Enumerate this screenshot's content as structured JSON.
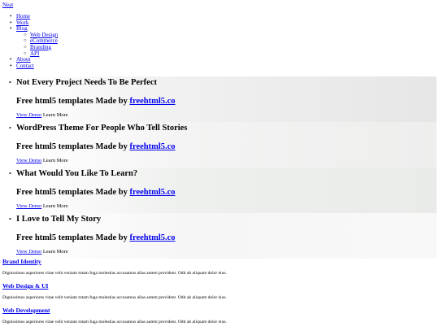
{
  "header": {
    "logo": "Neat"
  },
  "nav": {
    "home": "Home",
    "work": "Work",
    "blog": "Blog",
    "blog_sub": [
      "Web Design",
      "eCommerce",
      "Branding",
      "API"
    ],
    "about": "About",
    "contact": "Contact"
  },
  "slides": [
    {
      "title": "Not Every Project Needs To Be Perfect",
      "subtitle_prefix": "Free html5 templates Made by ",
      "link": "freehtml5.co",
      "demo": "View Demo",
      "learn": "Learn More"
    },
    {
      "title": "WordPress Theme For People Who Tell Stories",
      "subtitle_prefix": "Free html5 templates Made by ",
      "link": "freehtml5.co",
      "demo": "View Demo",
      "learn": "Learn More"
    },
    {
      "title": "What Would You Like To Learn?",
      "subtitle_prefix": "Free html5 templates Made by ",
      "link": "freehtml5.co",
      "demo": "View Demo",
      "learn": "Learn More"
    },
    {
      "title": "I Love to Tell My Story",
      "subtitle_prefix": "Free html5 templates Made by ",
      "link": "freehtml5.co",
      "demo": "View Demo",
      "learn": "Learn More"
    }
  ],
  "services": [
    {
      "title": "Brand Identity",
      "text": "Dignissimos asperiores vitae velit veniam totam fuga molestias accusamus alias autem provident. Odit ab aliquam dolor eius."
    },
    {
      "title": "Web Design & UI",
      "text": "Dignissimos asperiores vitae velit veniam totam fuga molestias accusamus alias autem provident. Odit ab aliquam dolor eius."
    },
    {
      "title": "Web Development",
      "text": "Dignissimos asperiores vitae velit veniam totam fuga molestias accusamus alias autem provident. Odit ab aliquam dolor eius."
    }
  ]
}
